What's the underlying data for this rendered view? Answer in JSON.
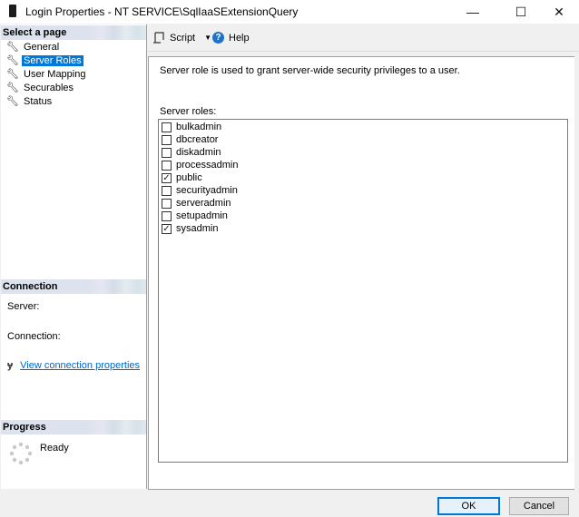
{
  "window": {
    "title": "Login Properties - NT SERVICE\\SqlIaaSExtensionQuery",
    "controls": {
      "minimize": "—",
      "maximize": "☐",
      "close": "✕"
    }
  },
  "sidebar": {
    "header": "Select a page",
    "items": [
      {
        "label": "General",
        "icon": "wrench-icon",
        "selected": false
      },
      {
        "label": "Server Roles",
        "icon": "wrench-icon",
        "selected": true
      },
      {
        "label": "User Mapping",
        "icon": "wrench-icon",
        "selected": false
      },
      {
        "label": "Securables",
        "icon": "wrench-icon",
        "selected": false
      },
      {
        "label": "Status",
        "icon": "wrench-icon",
        "selected": false
      }
    ]
  },
  "connection": {
    "header": "Connection",
    "server_label": "Server:",
    "connection_label": "Connection:",
    "view_link": "View connection properties"
  },
  "progress": {
    "header": "Progress",
    "status": "Ready"
  },
  "toolbar": {
    "script_label": "Script",
    "help_label": "Help"
  },
  "main": {
    "description": "Server role is used to grant server-wide security privileges to a user.",
    "roles_label": "Server roles:",
    "roles": [
      {
        "name": "bulkadmin",
        "checked": false
      },
      {
        "name": "dbcreator",
        "checked": false
      },
      {
        "name": "diskadmin",
        "checked": false
      },
      {
        "name": "processadmin",
        "checked": false
      },
      {
        "name": "public",
        "checked": true
      },
      {
        "name": "securityadmin",
        "checked": false
      },
      {
        "name": "serveradmin",
        "checked": false
      },
      {
        "name": "setupadmin",
        "checked": false
      },
      {
        "name": "sysadmin",
        "checked": true
      }
    ]
  },
  "footer": {
    "ok_label": "OK",
    "cancel_label": "Cancel"
  },
  "colors": {
    "selection": "#0078d7",
    "link": "#0066cc",
    "help_icon": "#1e73c8"
  }
}
